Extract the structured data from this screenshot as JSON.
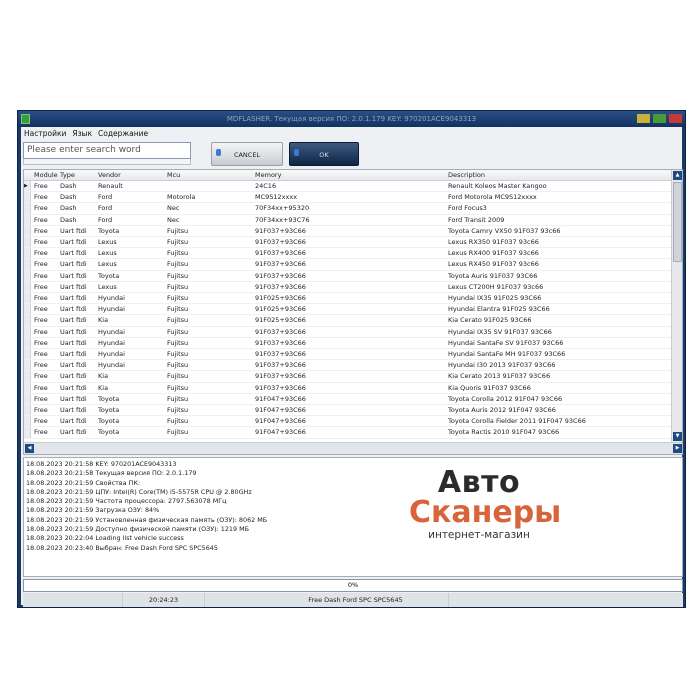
{
  "window": {
    "title": "MDFLASHER. Текущая версия ПО: 2.0.1.179  KEY: 970201ACE9043313"
  },
  "menu": [
    "Настройки",
    "Язык",
    "Содержание"
  ],
  "toolbar": {
    "search_placeholder": "Please enter search word",
    "cancel_label": "CANCEL",
    "ok_label": "OK"
  },
  "grid": {
    "columns": [
      "Module",
      "Type",
      "Vendor",
      "Mcu",
      "Memory",
      "Description"
    ],
    "rows": [
      [
        "Free",
        "Dash",
        "Renault",
        "",
        "24C16",
        "Renault Koleos Master Kangoo"
      ],
      [
        "Free",
        "Dash",
        "Ford",
        "Motorola",
        "MC9S12xxxx",
        "Ford Motorola MC9S12xxxx"
      ],
      [
        "Free",
        "Dash",
        "Ford",
        "Nec",
        "70F34xx+95320",
        "Ford Focus3"
      ],
      [
        "Free",
        "Dash",
        "Ford",
        "Nec",
        "70F34xx+93C76",
        "Ford Transit 2009"
      ],
      [
        "Free",
        "Uart ftdi",
        "Toyota",
        "Fujitsu",
        "91F037+93C66",
        "Toyota Camry VX50 91F037 93c66"
      ],
      [
        "Free",
        "Uart ftdi",
        "Lexus",
        "Fujitsu",
        "91F037+93C66",
        "Lexus RX350 91F037 93c66"
      ],
      [
        "Free",
        "Uart ftdi",
        "Lexus",
        "Fujitsu",
        "91F037+93C66",
        "Lexus RX400 91F037 93c66"
      ],
      [
        "Free",
        "Uart ftdi",
        "Lexus",
        "Fujitsu",
        "91F037+93C66",
        "Lexus RX450 91F037 93c66"
      ],
      [
        "Free",
        "Uart ftdi",
        "Toyota",
        "Fujitsu",
        "91F037+93C66",
        "Toyota Auris 91F037 93C66"
      ],
      [
        "Free",
        "Uart ftdi",
        "Lexus",
        "Fujitsu",
        "91F037+93C66",
        "Lexus CT200H 91F037 93c66"
      ],
      [
        "Free",
        "Uart ftdi",
        "Hyundai",
        "Fujitsu",
        "91F025+93C66",
        "Hyundai IX35 91F025 93C66"
      ],
      [
        "Free",
        "Uart ftdi",
        "Hyundai",
        "Fujitsu",
        "91F025+93C66",
        "Hyundai Elantra 91F025 93C66"
      ],
      [
        "Free",
        "Uart ftdi",
        "Kia",
        "Fujitsu",
        "91F025+93C66",
        "Kia Cerato 91F025 93C66"
      ],
      [
        "Free",
        "Uart ftdi",
        "Hyundai",
        "Fujitsu",
        "91F037+93C66",
        "Hyundai IX35 SV 91F037 93C66"
      ],
      [
        "Free",
        "Uart ftdi",
        "Hyundai",
        "Fujitsu",
        "91F037+93C66",
        "Hyundai SantaFe SV 91F037 93C66"
      ],
      [
        "Free",
        "Uart ftdi",
        "Hyundai",
        "Fujitsu",
        "91F037+93C66",
        "Hyundai SantaFe MH 91F037 93C66"
      ],
      [
        "Free",
        "Uart ftdi",
        "Hyundai",
        "Fujitsu",
        "91F037+93C66",
        "Hyundai I30 2013 91F037 93C66"
      ],
      [
        "Free",
        "Uart ftdi",
        "Kia",
        "Fujitsu",
        "91F037+93C66",
        "Kia Cerato 2013 91F037 93C66"
      ],
      [
        "Free",
        "Uart ftdi",
        "Kia",
        "Fujitsu",
        "91F037+93C66",
        "Kia Quoris 91F037 93C66"
      ],
      [
        "Free",
        "Uart ftdi",
        "Toyota",
        "Fujitsu",
        "91F047+93C66",
        "Toyota Corolla 2012 91F047 93C66"
      ],
      [
        "Free",
        "Uart ftdi",
        "Toyota",
        "Fujitsu",
        "91F047+93C66",
        "Toyota Auris 2012 91F047 93C66"
      ],
      [
        "Free",
        "Uart ftdi",
        "Toyota",
        "Fujitsu",
        "91F047+93C66",
        "Toyota Corolla Fielder 2011 91F047 93C66"
      ],
      [
        "Free",
        "Uart ftdi",
        "Toyota",
        "Fujitsu",
        "91F047+93C66",
        "Toyota Ractis 2010 91F047 93C66"
      ]
    ]
  },
  "log": [
    "18.08.2023 20:21:58  KEY: 970201ACE9043313",
    "18.08.2023 20:21:58  Текущая версия ПО: 2.0.1.179",
    "18.08.2023 20:21:59  Свойства ПК:",
    "18.08.2023 20:21:59  ЦПУ: Intel(R) Core(TM) i5-5575R CPU @ 2.80GHz",
    "18.08.2023 20:21:59  Частота процессора: 2797.563078 МГц",
    "18.08.2023 20:21:59  Загрузка ОЗУ: 84%",
    "18.08.2023 20:21:59  Установленная физическая память (ОЗУ): 8062 МБ",
    "18.08.2023 20:21:59  Доступно физической памяти (ОЗУ): 1219 МБ",
    "18.08.2023 20:22:04  Loading list vehicle success",
    "18.08.2023 20:23:40  Выбран:   Free Dash Ford SPC SPC5645"
  ],
  "logo": {
    "line1": "Авто",
    "line2": "Сканеры",
    "line3": "интернет-магазин"
  },
  "progress": {
    "value": 0,
    "label": "0%"
  },
  "status": {
    "time": "20:24:23",
    "selected": "Free Dash Ford SPC SPC5645"
  }
}
